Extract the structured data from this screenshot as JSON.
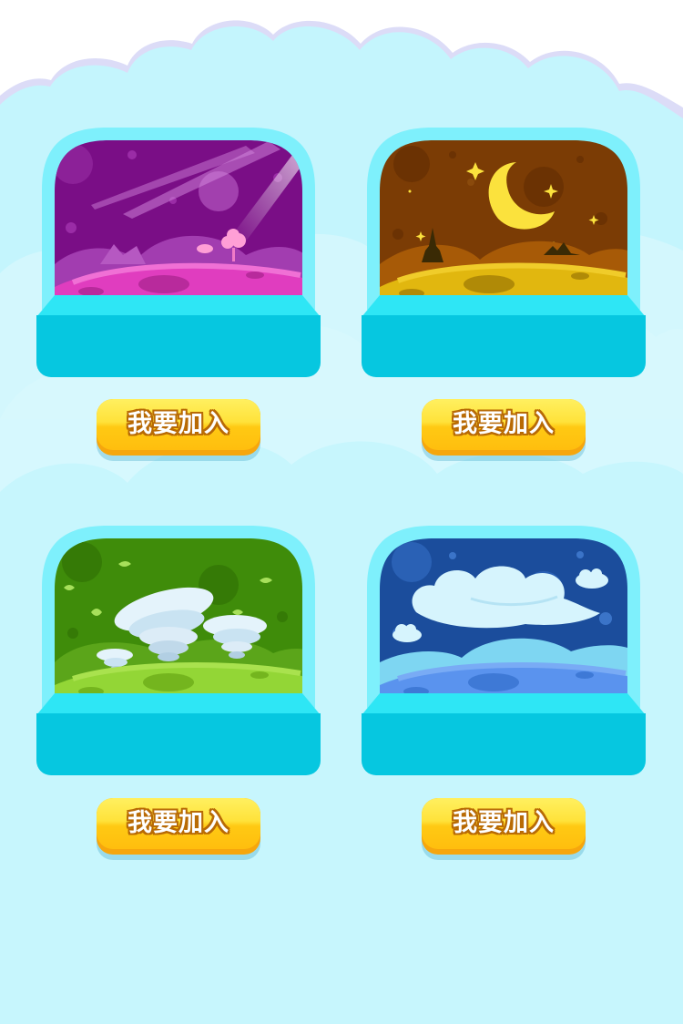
{
  "colors": {
    "background": "#c4f5fd",
    "frame": "#7ef0fc",
    "base": "#06c7e0",
    "button": "#ffcf18"
  },
  "cards": [
    {
      "scene": "pink-planet-night",
      "button_label": "我要加入"
    },
    {
      "scene": "moon-desert-night",
      "button_label": "我要加入"
    },
    {
      "scene": "green-tornado-field",
      "button_label": "我要加入"
    },
    {
      "scene": "blue-cloud-sky",
      "button_label": "我要加入"
    }
  ]
}
